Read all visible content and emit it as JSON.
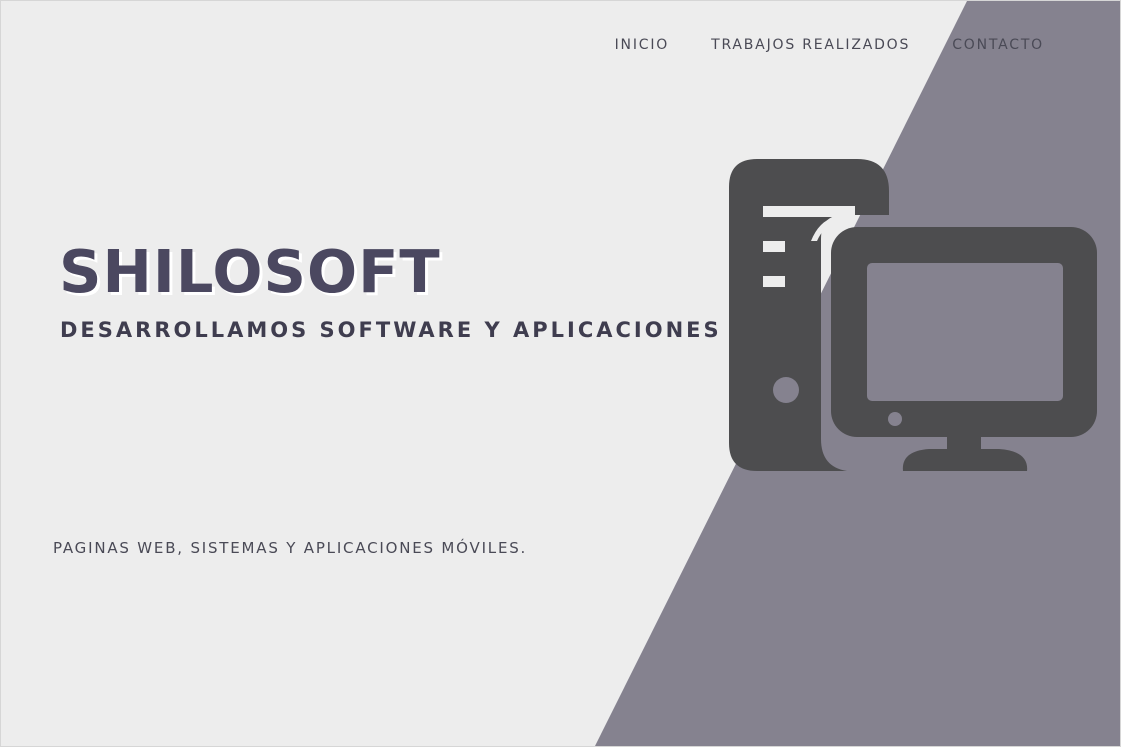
{
  "nav": {
    "items": [
      {
        "label": "INICIO"
      },
      {
        "label": "TRABAJOS REALIZADOS"
      },
      {
        "label": "CONTACTO"
      }
    ]
  },
  "hero": {
    "title": "SHILOSOFT",
    "subtitle": "DESARROLLAMOS SOFTWARE Y APLICACIONES",
    "tagline": "PAGINAS WEB, SISTEMAS Y APLICACIONES MÓVILES."
  },
  "illustration": {
    "icon": "desktop-computer-icon"
  },
  "colors": {
    "background": "#ededed",
    "band": "#85828f",
    "icon": "#4d4d4f",
    "title": "#4b4860",
    "text": "#4a4a56"
  }
}
